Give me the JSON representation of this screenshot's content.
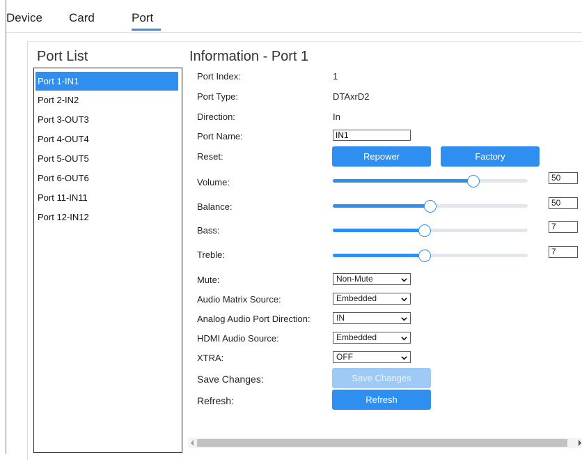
{
  "tabs": [
    {
      "label": "Device"
    },
    {
      "label": "Card"
    },
    {
      "label": "Port",
      "active": true
    }
  ],
  "port_list": {
    "title": "Port List",
    "selected_index": 0,
    "items": [
      {
        "label": "Port 1-IN1"
      },
      {
        "label": "Port 2-IN2"
      },
      {
        "label": "Port 3-OUT3"
      },
      {
        "label": "Port 4-OUT4"
      },
      {
        "label": "Port 5-OUT5"
      },
      {
        "label": "Port 6-OUT6"
      },
      {
        "label": "Port 11-IN11"
      },
      {
        "label": "Port 12-IN12"
      }
    ]
  },
  "info": {
    "title": "Information - Port 1",
    "port_index": {
      "label": "Port Index:",
      "value": "1"
    },
    "port_type": {
      "label": "Port Type:",
      "value": "DTAxrD2"
    },
    "direction": {
      "label": "Direction:",
      "value": "In"
    },
    "port_name": {
      "label": "Port Name:",
      "value": "IN1"
    },
    "reset": {
      "label": "Reset:",
      "repower_label": "Repower",
      "factory_label": "Factory"
    },
    "volume": {
      "label": "Volume:",
      "value": "50",
      "level_fraction": 0.72
    },
    "balance": {
      "label": "Balance:",
      "value": "50",
      "level_fraction": 0.5
    },
    "bass": {
      "label": "Bass:",
      "value": "7",
      "level_fraction": 0.47
    },
    "treble": {
      "label": "Treble:",
      "value": "7",
      "level_fraction": 0.47
    },
    "mute": {
      "label": "Mute:",
      "value": "Non-Mute"
    },
    "audio_matrix_source": {
      "label": "Audio Matrix Source:",
      "value": "Embedded"
    },
    "analog_audio_port_direction": {
      "label": "Analog Audio Port Direction:",
      "value": "IN"
    },
    "hdmi_audio_source": {
      "label": "HDMI Audio Source:",
      "value": "Embedded"
    },
    "xtra": {
      "label": "XTRA:",
      "value": "OFF"
    },
    "save_changes": {
      "label": "Save Changes:",
      "button_label": "Save Changes",
      "enabled": false
    },
    "refresh": {
      "label": "Refresh:",
      "button_label": "Refresh"
    }
  },
  "colors": {
    "accent": "#2f8ff0",
    "accent_disabled": "#9fcaf6",
    "track": "#e2e7ee"
  },
  "icons": {
    "dropdown": "chevron-down-icon",
    "scroll_left": "arrow-left-icon",
    "scroll_right": "arrow-right-icon"
  }
}
